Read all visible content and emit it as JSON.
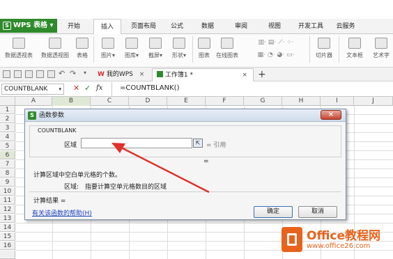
{
  "app": {
    "name": "WPS 表格",
    "logo_letter": "S"
  },
  "menus": [
    "开始",
    "插入",
    "页面布局",
    "公式",
    "数据",
    "审阅",
    "视图",
    "开发工具",
    "云服务"
  ],
  "active_menu": "插入",
  "ribbon": {
    "items": [
      "数据透视表",
      "数据透视图",
      "表格",
      "图片",
      "图库",
      "截屏",
      "形状",
      "图表",
      "在线图表",
      "切片器",
      "文本框",
      "艺术字"
    ]
  },
  "tabs": {
    "doc1": "我的WPS",
    "doc2": "工作簿1 *",
    "close": "×",
    "add": "+"
  },
  "formula_bar": {
    "name_box": "COUNTBLANK",
    "fx": "fx",
    "formula": "=COUNTBLANK()"
  },
  "columns": [
    "A",
    "B",
    "C",
    "D",
    "E",
    "F",
    "G",
    "H",
    "I",
    "J"
  ],
  "rows": [
    "1",
    "2",
    "3",
    "4",
    "5",
    "6",
    "7",
    "8",
    "9",
    "10",
    "11",
    "12",
    "13",
    "14",
    "15",
    "16"
  ],
  "dialog": {
    "title": "函数参数",
    "close": "×",
    "function_name": "COUNTBLANK",
    "field_label": "区域",
    "field_value": "",
    "equals_ref": "= 引用",
    "equals_result": "=",
    "description": "计算区域中空白单元格的个数。",
    "param_name": "区域:",
    "param_desc": "指要计算空单元格数目的区域",
    "result_label": "计算结果 =",
    "help_link": "有关该函数的帮助(H)",
    "ok": "确定",
    "cancel": "取消"
  },
  "watermark": {
    "line1": "Office教程网",
    "line2": "www.office26.com"
  },
  "colors": {
    "brand": "#2f8a2b",
    "accent_orange": "#e8631c",
    "arrow": "#e0312b"
  }
}
